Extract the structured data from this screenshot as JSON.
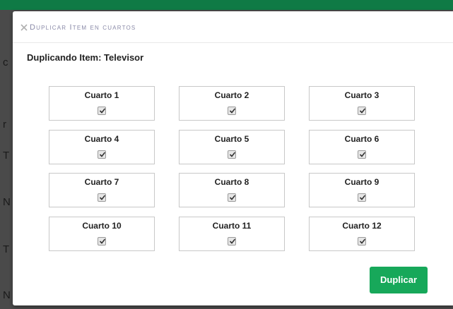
{
  "modal": {
    "title": "Duplicar Item en cuartos",
    "subtitle": "Duplicando Item: Televisor",
    "rooms": [
      {
        "label": "Cuarto 1",
        "checked": true
      },
      {
        "label": "Cuarto 2",
        "checked": true
      },
      {
        "label": "Cuarto 3",
        "checked": true
      },
      {
        "label": "Cuarto 4",
        "checked": true
      },
      {
        "label": "Cuarto 5",
        "checked": true
      },
      {
        "label": "Cuarto 6",
        "checked": true
      },
      {
        "label": "Cuarto 7",
        "checked": true
      },
      {
        "label": "Cuarto 8",
        "checked": true
      },
      {
        "label": "Cuarto 9",
        "checked": true
      },
      {
        "label": "Cuarto 10",
        "checked": true
      },
      {
        "label": "Cuarto 11",
        "checked": true
      },
      {
        "label": "Cuarto 12",
        "checked": true
      }
    ],
    "button_label": "Duplicar",
    "close_icon": "close-icon"
  },
  "colors": {
    "accent": "#17a85a",
    "header_bar": "#0f7a45",
    "title_text": "#8a8aa8"
  }
}
